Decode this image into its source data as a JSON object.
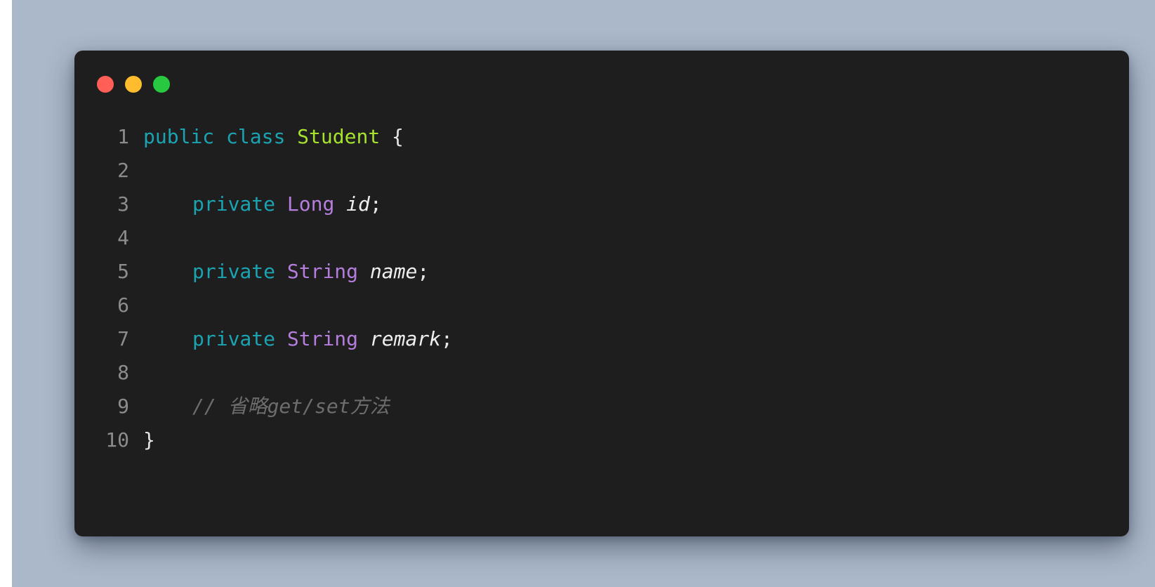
{
  "window": {
    "controls": [
      {
        "name": "close",
        "color": "#ff5f57"
      },
      {
        "name": "minimize",
        "color": "#febc2e"
      },
      {
        "name": "maximize",
        "color": "#28c840"
      }
    ]
  },
  "code": {
    "lines": [
      {
        "number": "1",
        "kw1": "public",
        "kw2": "class",
        "class_name": "Student",
        "brace": "{"
      },
      {
        "number": "2"
      },
      {
        "number": "3",
        "modifier": "private",
        "type": "Long",
        "field": "id",
        "semi": ";"
      },
      {
        "number": "4"
      },
      {
        "number": "5",
        "modifier": "private",
        "type": "String",
        "field": "name",
        "semi": ";"
      },
      {
        "number": "6"
      },
      {
        "number": "7",
        "modifier": "private",
        "type": "String",
        "field": "remark",
        "semi": ";"
      },
      {
        "number": "8"
      },
      {
        "number": "9",
        "comment": "// 省略get/set方法"
      },
      {
        "number": "10",
        "brace": "}"
      }
    ]
  },
  "colors": {
    "background": "#abb8c9",
    "editor": "#1e1e1e",
    "keyword": "#1ba3b2",
    "class_name": "#a6e22e",
    "type": "#b57edc",
    "comment": "#6d6d6d"
  }
}
